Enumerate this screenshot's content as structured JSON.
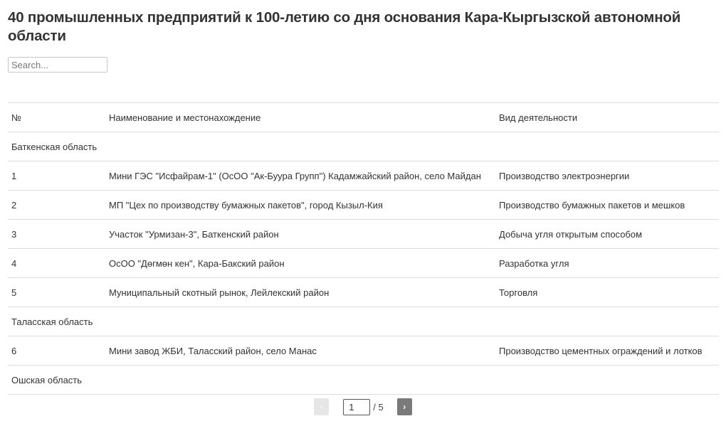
{
  "page": {
    "title": "40 промышленных предприятий к 100-летию со дня основания Кара-Кыргызской автономной области"
  },
  "search": {
    "placeholder": "Search...",
    "value": ""
  },
  "table": {
    "headers": [
      "№",
      "Наименование и местонахождение",
      "Вид деятельности"
    ],
    "rows": [
      {
        "type": "group",
        "label": "Баткенская область"
      },
      {
        "type": "item",
        "num": "1",
        "name": "Мини ГЭС \"Исфайрам-1\" (ОсОО \"Ак-Буура Групп\") Кадамжайский район, село Майдан",
        "activity": "Производство электроэнергии"
      },
      {
        "type": "item",
        "num": "2",
        "name": "МП \"Цех по производству бумажных пакетов\", город Кызыл-Кия",
        "activity": "Производство бумажных пакетов и мешков"
      },
      {
        "type": "item",
        "num": "3",
        "name": "Участок \"Урмизан-3\", Баткенский район",
        "activity": "Добыча угля открытым способом"
      },
      {
        "type": "item",
        "num": "4",
        "name": "ОсОО \"Дөгмөн кен\", Кара-Бакский район",
        "activity": "Разработка угля"
      },
      {
        "type": "item",
        "num": "5",
        "name": "Муниципальный скотный рынок, Лейлекский район",
        "activity": "Торговля"
      },
      {
        "type": "group",
        "label": "Таласская область"
      },
      {
        "type": "item",
        "num": "6",
        "name": "Мини завод ЖБИ, Таласский район, село Манас",
        "activity": "Производство цементных ограждений и лотков"
      },
      {
        "type": "group",
        "label": "Ошская область"
      }
    ]
  },
  "pagination": {
    "prev_label": "‹",
    "next_label": "›",
    "current_page": "1",
    "total_label": "/ 5",
    "prev_icon": "chevron-left-icon",
    "next_icon": "chevron-right-icon"
  }
}
